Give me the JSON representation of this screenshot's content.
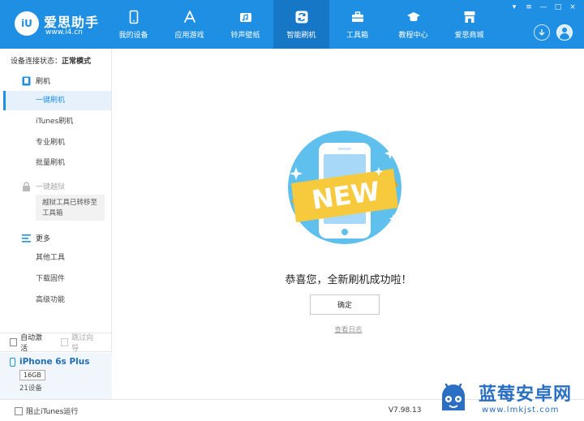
{
  "header": {
    "logo_text": "iU",
    "brand_name": "爱思助手",
    "brand_url": "www.i4.cn",
    "nav": [
      {
        "label": "我的设备",
        "icon": "phone-icon"
      },
      {
        "label": "应用游戏",
        "icon": "app-store-icon"
      },
      {
        "label": "铃声壁纸",
        "icon": "ringtone-icon"
      },
      {
        "label": "智能刷机",
        "icon": "refresh-icon",
        "active": true
      },
      {
        "label": "工具箱",
        "icon": "toolbox-icon"
      },
      {
        "label": "教程中心",
        "icon": "graduation-cap-icon"
      },
      {
        "label": "爱思商城",
        "icon": "shop-icon"
      }
    ],
    "window_controls": [
      "▾",
      "≡",
      "—",
      "□",
      "×"
    ]
  },
  "sidebar": {
    "status_label": "设备连接状态：",
    "status_value": "正常模式",
    "flash_section": "刷机",
    "items": [
      {
        "label": "一键刷机",
        "active": true
      },
      {
        "label": "iTunes刷机"
      },
      {
        "label": "专业刷机"
      },
      {
        "label": "批量刷机"
      }
    ],
    "jailbreak_section": "一键越狱",
    "jailbreak_notice": "越狱工具已转移至工具箱",
    "more_section": "更多",
    "more_items": [
      {
        "label": "其他工具"
      },
      {
        "label": "下载固件"
      },
      {
        "label": "高级功能"
      }
    ],
    "auto_activate": "自动激活",
    "skip_guide": "跳过向导",
    "device": {
      "name": "iPhone 6s Plus",
      "capacity": "16GB",
      "count": "21设备"
    }
  },
  "main": {
    "badge_text": "NEW",
    "success_message": "恭喜您，全新刷机成功啦！",
    "confirm_button": "确定",
    "view_log": "查看日志"
  },
  "footer": {
    "block_itunes": "阻止iTunes运行",
    "version": "V7.98.13"
  },
  "watermark": {
    "cn": "蓝莓安卓网",
    "url": "www.lmkjst.com"
  },
  "colors": {
    "header_bg": "#1f8fe3",
    "nav_active_bg": "#1677c6",
    "accent": "#1f8fe3",
    "ribbon": "#f7c93c"
  }
}
